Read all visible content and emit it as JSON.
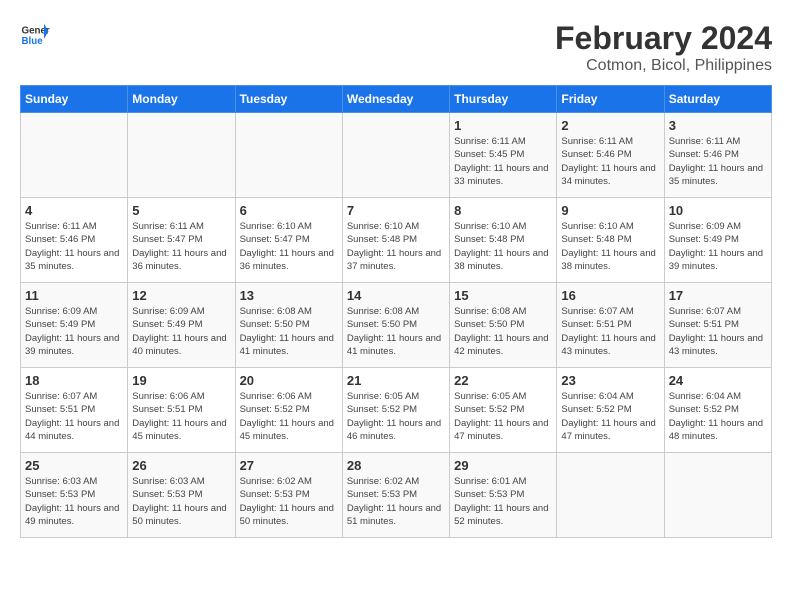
{
  "header": {
    "logo_line1": "General",
    "logo_line2": "Blue",
    "title": "February 2024",
    "subtitle": "Cotmon, Bicol, Philippines"
  },
  "days_of_week": [
    "Sunday",
    "Monday",
    "Tuesday",
    "Wednesday",
    "Thursday",
    "Friday",
    "Saturday"
  ],
  "weeks": [
    [
      {
        "day": "",
        "sunrise": "",
        "sunset": "",
        "daylight": ""
      },
      {
        "day": "",
        "sunrise": "",
        "sunset": "",
        "daylight": ""
      },
      {
        "day": "",
        "sunrise": "",
        "sunset": "",
        "daylight": ""
      },
      {
        "day": "",
        "sunrise": "",
        "sunset": "",
        "daylight": ""
      },
      {
        "day": "1",
        "sunrise": "6:11 AM",
        "sunset": "5:45 PM",
        "daylight": "11 hours and 33 minutes."
      },
      {
        "day": "2",
        "sunrise": "6:11 AM",
        "sunset": "5:46 PM",
        "daylight": "11 hours and 34 minutes."
      },
      {
        "day": "3",
        "sunrise": "6:11 AM",
        "sunset": "5:46 PM",
        "daylight": "11 hours and 35 minutes."
      }
    ],
    [
      {
        "day": "4",
        "sunrise": "6:11 AM",
        "sunset": "5:46 PM",
        "daylight": "11 hours and 35 minutes."
      },
      {
        "day": "5",
        "sunrise": "6:11 AM",
        "sunset": "5:47 PM",
        "daylight": "11 hours and 36 minutes."
      },
      {
        "day": "6",
        "sunrise": "6:10 AM",
        "sunset": "5:47 PM",
        "daylight": "11 hours and 36 minutes."
      },
      {
        "day": "7",
        "sunrise": "6:10 AM",
        "sunset": "5:48 PM",
        "daylight": "11 hours and 37 minutes."
      },
      {
        "day": "8",
        "sunrise": "6:10 AM",
        "sunset": "5:48 PM",
        "daylight": "11 hours and 38 minutes."
      },
      {
        "day": "9",
        "sunrise": "6:10 AM",
        "sunset": "5:48 PM",
        "daylight": "11 hours and 38 minutes."
      },
      {
        "day": "10",
        "sunrise": "6:09 AM",
        "sunset": "5:49 PM",
        "daylight": "11 hours and 39 minutes."
      }
    ],
    [
      {
        "day": "11",
        "sunrise": "6:09 AM",
        "sunset": "5:49 PM",
        "daylight": "11 hours and 39 minutes."
      },
      {
        "day": "12",
        "sunrise": "6:09 AM",
        "sunset": "5:49 PM",
        "daylight": "11 hours and 40 minutes."
      },
      {
        "day": "13",
        "sunrise": "6:08 AM",
        "sunset": "5:50 PM",
        "daylight": "11 hours and 41 minutes."
      },
      {
        "day": "14",
        "sunrise": "6:08 AM",
        "sunset": "5:50 PM",
        "daylight": "11 hours and 41 minutes."
      },
      {
        "day": "15",
        "sunrise": "6:08 AM",
        "sunset": "5:50 PM",
        "daylight": "11 hours and 42 minutes."
      },
      {
        "day": "16",
        "sunrise": "6:07 AM",
        "sunset": "5:51 PM",
        "daylight": "11 hours and 43 minutes."
      },
      {
        "day": "17",
        "sunrise": "6:07 AM",
        "sunset": "5:51 PM",
        "daylight": "11 hours and 43 minutes."
      }
    ],
    [
      {
        "day": "18",
        "sunrise": "6:07 AM",
        "sunset": "5:51 PM",
        "daylight": "11 hours and 44 minutes."
      },
      {
        "day": "19",
        "sunrise": "6:06 AM",
        "sunset": "5:51 PM",
        "daylight": "11 hours and 45 minutes."
      },
      {
        "day": "20",
        "sunrise": "6:06 AM",
        "sunset": "5:52 PM",
        "daylight": "11 hours and 45 minutes."
      },
      {
        "day": "21",
        "sunrise": "6:05 AM",
        "sunset": "5:52 PM",
        "daylight": "11 hours and 46 minutes."
      },
      {
        "day": "22",
        "sunrise": "6:05 AM",
        "sunset": "5:52 PM",
        "daylight": "11 hours and 47 minutes."
      },
      {
        "day": "23",
        "sunrise": "6:04 AM",
        "sunset": "5:52 PM",
        "daylight": "11 hours and 47 minutes."
      },
      {
        "day": "24",
        "sunrise": "6:04 AM",
        "sunset": "5:52 PM",
        "daylight": "11 hours and 48 minutes."
      }
    ],
    [
      {
        "day": "25",
        "sunrise": "6:03 AM",
        "sunset": "5:53 PM",
        "daylight": "11 hours and 49 minutes."
      },
      {
        "day": "26",
        "sunrise": "6:03 AM",
        "sunset": "5:53 PM",
        "daylight": "11 hours and 50 minutes."
      },
      {
        "day": "27",
        "sunrise": "6:02 AM",
        "sunset": "5:53 PM",
        "daylight": "11 hours and 50 minutes."
      },
      {
        "day": "28",
        "sunrise": "6:02 AM",
        "sunset": "5:53 PM",
        "daylight": "11 hours and 51 minutes."
      },
      {
        "day": "29",
        "sunrise": "6:01 AM",
        "sunset": "5:53 PM",
        "daylight": "11 hours and 52 minutes."
      },
      {
        "day": "",
        "sunrise": "",
        "sunset": "",
        "daylight": ""
      },
      {
        "day": "",
        "sunrise": "",
        "sunset": "",
        "daylight": ""
      }
    ]
  ]
}
